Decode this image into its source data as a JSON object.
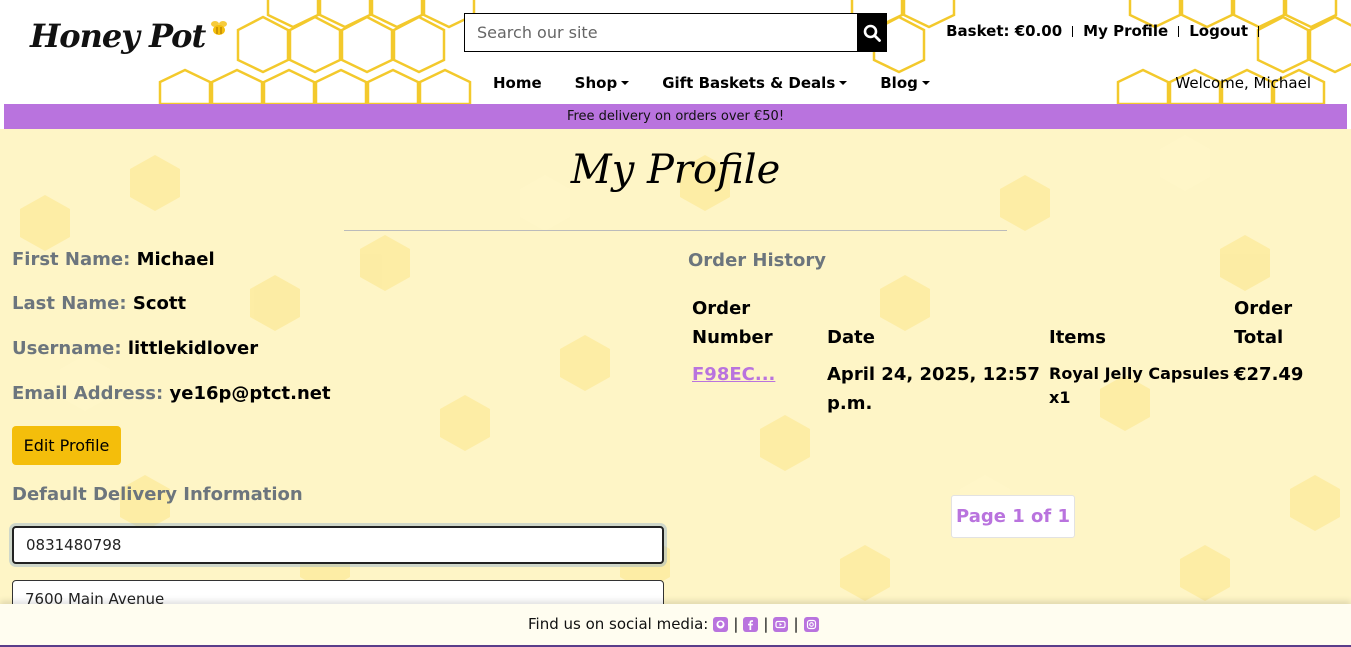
{
  "brand": {
    "logo_text": "Honey Pot"
  },
  "search": {
    "placeholder": "Search our site"
  },
  "top_links": {
    "basket": "Basket: €0.00",
    "profile": "My Profile",
    "logout": "Logout"
  },
  "nav": {
    "home": "Home",
    "shop": "Shop",
    "gifts": "Gift Baskets & Deals",
    "blog": "Blog"
  },
  "welcome": "Welcome, Michael",
  "banner": "Free delivery on orders over €50!",
  "page_title": "My Profile",
  "profile": {
    "first_name_label": "First Name:",
    "first_name": "Michael",
    "last_name_label": "Last Name:",
    "last_name": "Scott",
    "username_label": "Username:",
    "username": "littlekidlover",
    "email_label": "Email Address:",
    "email": "ye16p@ptct.net",
    "edit_button": "Edit Profile"
  },
  "delivery": {
    "heading": "Default Delivery Information",
    "phone": "0831480798",
    "address": "7600 Main Avenue",
    "address2": ""
  },
  "orders": {
    "heading": "Order History",
    "columns": {
      "order_number_1": "Order",
      "order_number_2": "Number",
      "date": "Date",
      "items": "Items",
      "total_1": "Order",
      "total_2": "Total"
    },
    "rows": [
      {
        "number": "F98EC...",
        "date_1": "April 24, 2025, 12:57",
        "date_2": "p.m.",
        "items_1": "Royal Jelly Capsules",
        "items_2": "x1",
        "total": "€27.49"
      }
    ],
    "pagination": "Page 1 of 1"
  },
  "footer": {
    "text": "Find us on social media:",
    "separator": "|"
  },
  "colors": {
    "accent": "#b973de",
    "button": "#f4be0b",
    "honey": "#fef5c6",
    "hex_outline": "#f3c92c"
  },
  "icons": [
    "search-icon",
    "github-icon",
    "facebook-icon",
    "youtube-icon",
    "instagram-icon"
  ]
}
